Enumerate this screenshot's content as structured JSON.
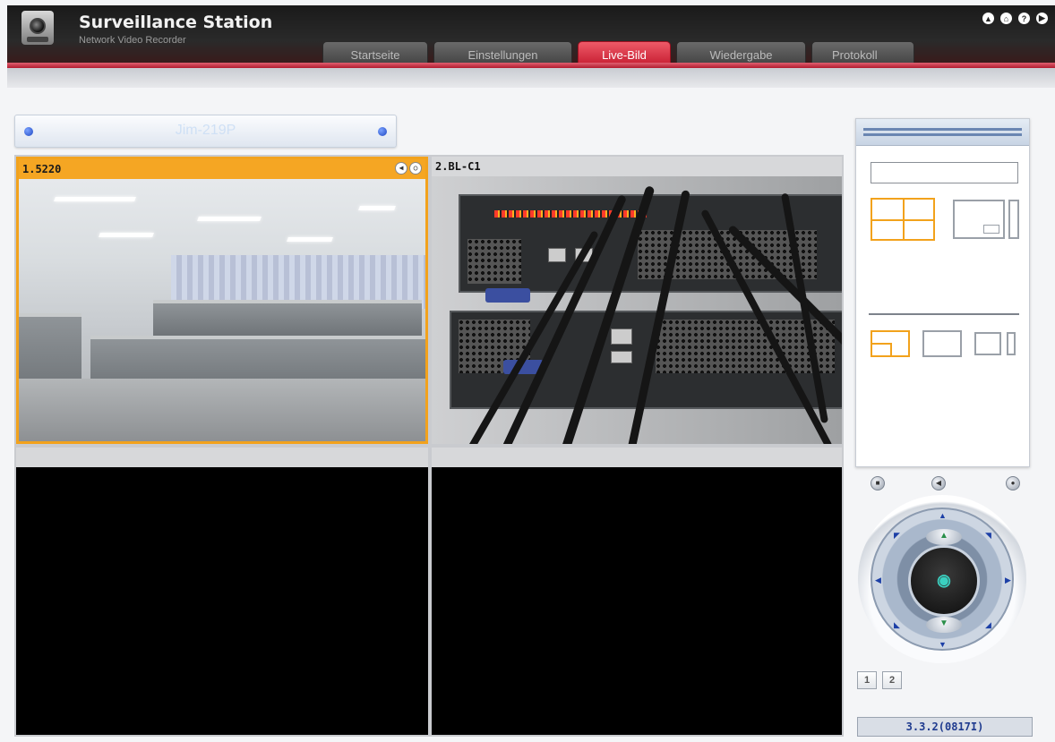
{
  "app": {
    "title": "Surveillance Station",
    "subtitle": "Network Video Recorder"
  },
  "top_icons": [
    "up-circle-icon",
    "home-icon",
    "help-icon",
    "next-icon"
  ],
  "tabs": [
    {
      "label": "Startseite",
      "active": false
    },
    {
      "label": "Einstellungen",
      "active": false
    },
    {
      "label": "Live-Bild",
      "active": true
    },
    {
      "label": "Wiedergabe",
      "active": false
    },
    {
      "label": "Protokoll",
      "active": false
    }
  ],
  "server": {
    "name": "Jim-219P"
  },
  "cameras": [
    {
      "label": "1.5220",
      "selected": true
    },
    {
      "label": "2.BL-C1",
      "selected": false
    },
    {
      "label": "",
      "selected": false
    },
    {
      "label": "",
      "selected": false
    }
  ],
  "pages": [
    "1",
    "2"
  ],
  "version": "3.3.2(0817I)",
  "colors": {
    "accent_active_tab": "#c2162b",
    "selected_camera_border": "#f2a21c",
    "version_text": "#1f3b8f"
  }
}
